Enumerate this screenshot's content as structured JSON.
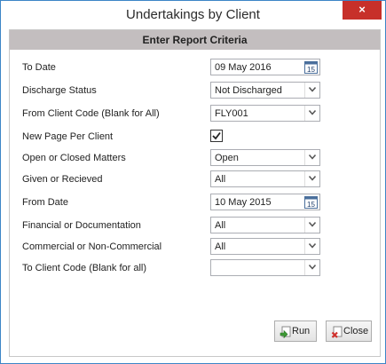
{
  "window": {
    "title": "Undertakings by Client",
    "close_glyph": "×"
  },
  "panel": {
    "header": "Enter Report Criteria"
  },
  "fields": [
    {
      "label": "To Date",
      "value": "09 May 2016",
      "type": "date"
    },
    {
      "label": "Discharge Status",
      "value": "Not Discharged",
      "type": "select"
    },
    {
      "label": "From Client Code (Blank for All)",
      "value": "FLY001",
      "type": "select"
    },
    {
      "label": "New Page Per Client",
      "value": "checked",
      "type": "checkbox"
    },
    {
      "label": "Open or Closed Matters",
      "value": "Open",
      "type": "select"
    },
    {
      "label": "Given or Recieved",
      "value": "All",
      "type": "select"
    },
    {
      "label": "From Date",
      "value": "10 May 2015",
      "type": "date"
    },
    {
      "label": "Financial or Documentation",
      "value": "All",
      "type": "select"
    },
    {
      "label": "Commercial or Non-Commercial",
      "value": "All",
      "type": "select"
    },
    {
      "label": "To Client Code (Blank for all)",
      "value": "",
      "type": "select"
    }
  ],
  "calendar_day": "15",
  "buttons": {
    "run": "Run",
    "close": "Close"
  },
  "icons": {
    "dropdown": "chevron-down-icon",
    "calendar": "calendar-icon",
    "checkmark": "checkmark-icon",
    "run": "run-icon",
    "close": "close-icon"
  }
}
